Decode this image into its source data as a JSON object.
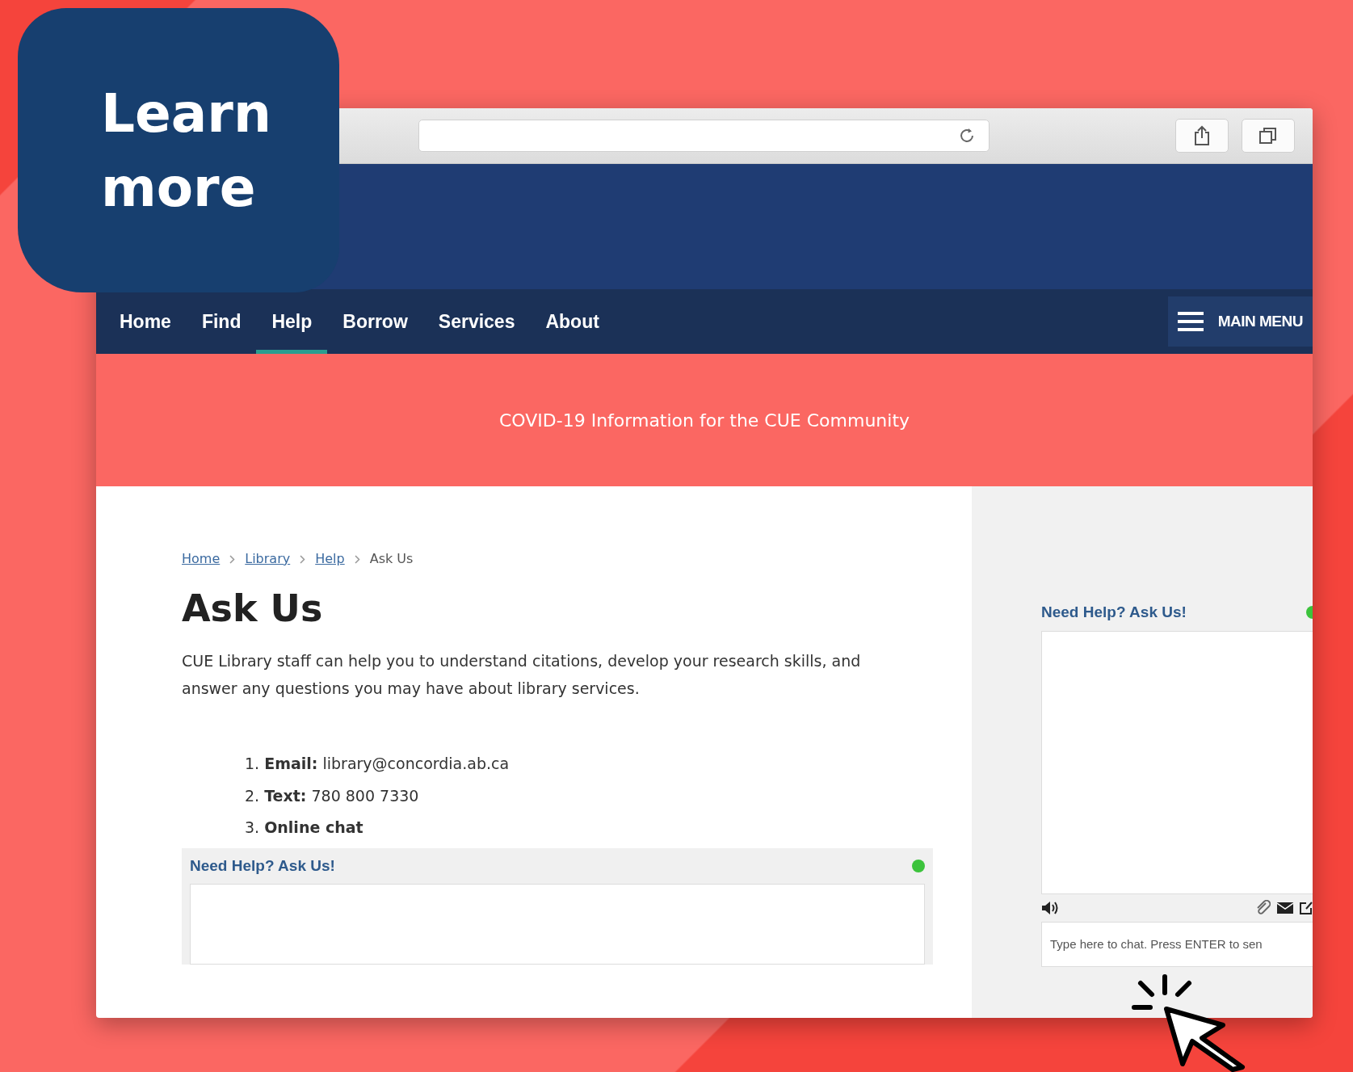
{
  "overlay": {
    "text": "Learn more"
  },
  "nav": {
    "items": [
      {
        "label": "Home",
        "selected": false
      },
      {
        "label": "Find",
        "selected": false
      },
      {
        "label": "Help",
        "selected": true
      },
      {
        "label": "Borrow",
        "selected": false
      },
      {
        "label": "Services",
        "selected": false
      },
      {
        "label": "About",
        "selected": false
      }
    ],
    "main_menu": "MAIN MENU"
  },
  "banner": {
    "text": "COVID-19 Information for the CUE Community"
  },
  "breadcrumbs": [
    {
      "label": "Home",
      "kind": "link"
    },
    {
      "label": "Library",
      "kind": "link"
    },
    {
      "label": "Help",
      "kind": "link"
    },
    {
      "label": "Ask Us",
      "kind": "current"
    }
  ],
  "title": "Ask Us",
  "intro": "CUE Library staff can help you to understand citations, develop your research skills, and answer any questions you may have about library services.",
  "contacts": [
    {
      "text": "1. **Email:**  library@concordia.ab.ca"
    },
    {
      "text": "2. **Text:** 780 800 7330"
    },
    {
      "text": "3. **Online chat**"
    }
  ],
  "chat_main": {
    "title": "Need Help? Ask Us!",
    "online": true
  },
  "chat_side": {
    "title": "Need Help? Ask Us!",
    "online": true,
    "placeholder": "Type here to chat. Press ENTER to sen"
  }
}
